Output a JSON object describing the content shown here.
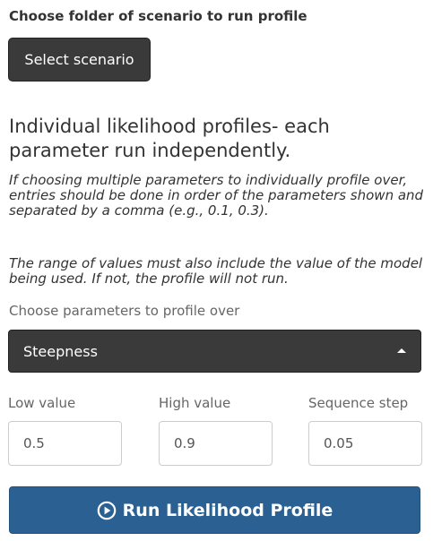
{
  "folder_section": {
    "label": "Choose folder of scenario to run profile",
    "button_label": "Select scenario"
  },
  "profiles": {
    "heading": "Individual likelihood profiles- each parameter run independently.",
    "note_1": "If choosing multiple parameters to individually profile over, entries should be done in order of the parameters shown and separated by a comma (e.g., 0.1, 0.3).",
    "note_2": "The range of values must also include the value of the model being used. If not, the profile will not run."
  },
  "parameters": {
    "label": "Choose parameters to profile over",
    "selected": "Steepness",
    "icon": "caret-up-icon"
  },
  "range": {
    "low": {
      "label": "Low value",
      "value": "0.5"
    },
    "high": {
      "label": "High value",
      "value": "0.9"
    },
    "step": {
      "label": "Sequence step",
      "value": "0.05"
    }
  },
  "run_button": {
    "label": "Run Likelihood Profile",
    "icon": "play-circle-icon"
  },
  "colors": {
    "dark_button": "#3a3a3a",
    "primary_button": "#2b6192",
    "muted_text": "#666666"
  }
}
